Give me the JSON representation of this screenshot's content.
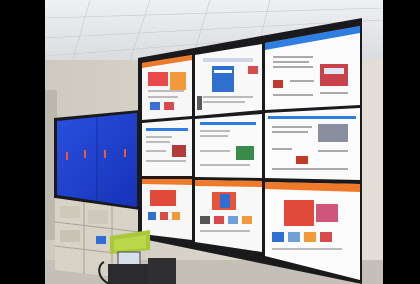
{
  "scene": {
    "subject": "video wall",
    "colors": {
      "letterbox": "#000000",
      "ceiling": "#e4e6ea",
      "wall": "#d9d6cf",
      "floor": "#c9c5bd",
      "bezel": "#1a1a1c",
      "blue_screen": "#1d3fcf",
      "accent_blue": "#2f7de0",
      "accent_orange": "#f07a2a",
      "page_white": "#fbfbfb"
    },
    "wall_grid": {
      "rows": 3,
      "cols": 3
    }
  }
}
